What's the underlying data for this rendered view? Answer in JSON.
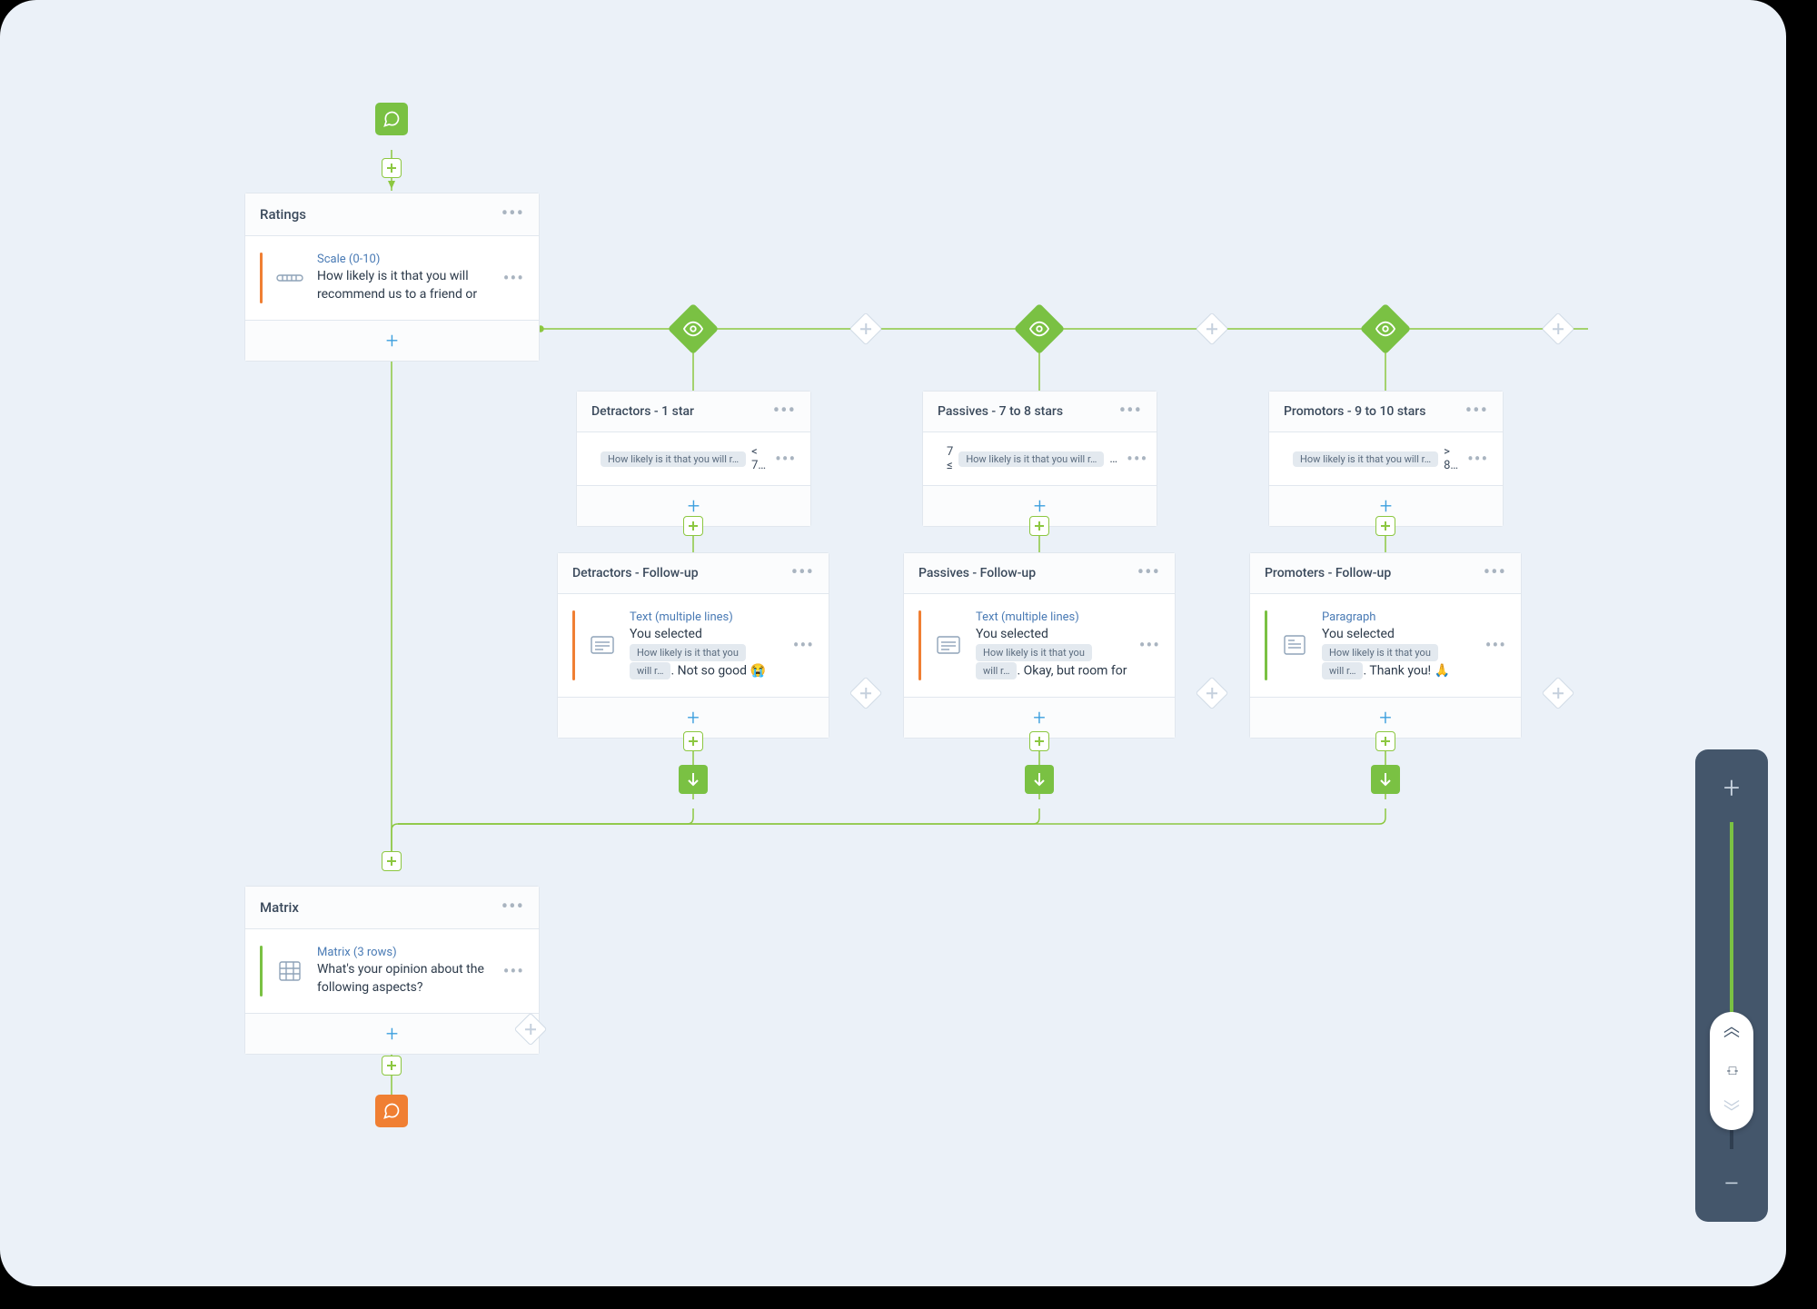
{
  "canvas": {
    "ratings": {
      "title": "Ratings",
      "item": {
        "type_label": "Scale (0-10)",
        "question": "How likely is it that you will recommend us to a friend or"
      }
    },
    "branches": {
      "detractors": {
        "condition_title": "Detractors - 1 star",
        "condition_chip": "How likely is it that you will r…",
        "condition_op": "< 7…",
        "followup_title": "Detractors - Follow-up",
        "followup_type": "Text (multiple lines)",
        "followup_prefix": "You selected",
        "followup_chip_a": "How likely is it that you",
        "followup_chip_b": "will r…",
        "followup_tail": ". Not so good 😭"
      },
      "passives": {
        "condition_title": "Passives - 7 to 8 stars",
        "condition_prefix": "7 ≤",
        "condition_chip": "How likely is it that you will r…",
        "condition_trail": "…",
        "followup_title": "Passives - Follow-up",
        "followup_type": "Text (multiple lines)",
        "followup_prefix": "You selected",
        "followup_chip_a": "How likely is it that you",
        "followup_chip_b": "will r…",
        "followup_tail": ". Okay, but room for"
      },
      "promoters": {
        "condition_title": "Promotors - 9 to 10 stars",
        "condition_chip": "How likely is it that you will r…",
        "condition_op": "> 8…",
        "followup_title": "Promoters - Follow-up",
        "followup_type": "Paragraph",
        "followup_prefix": "You selected",
        "followup_chip_a": "How likely is it that you",
        "followup_chip_b": "will r…",
        "followup_tail": ". Thank you! 🙏"
      }
    },
    "matrix": {
      "title": "Matrix",
      "item": {
        "type_label": "Matrix (3 rows)",
        "question": "What's your opinion about the following aspects?"
      }
    }
  }
}
